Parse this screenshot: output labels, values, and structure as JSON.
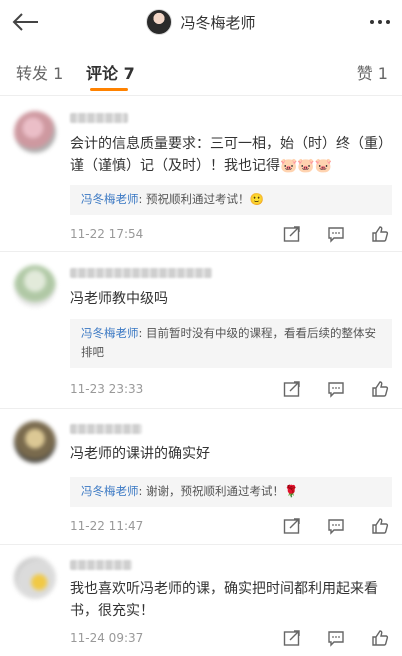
{
  "header": {
    "title": "冯冬梅老师"
  },
  "tabs": [
    {
      "label": "转发 1"
    },
    {
      "label": "评论 7"
    },
    {
      "label": "赞 1"
    }
  ],
  "colors": {
    "accent": "#ff8200",
    "link": "#3a78c3",
    "reply_bg": "#f5f5f5"
  },
  "comments": [
    {
      "text": "会计的信息质量要求：三可一相，始（时）终（重）谨（谨慎）记（及时）！我也记得🐷🐷🐷",
      "reply_author": "冯冬梅老师",
      "reply_text": ": 预祝顺利通过考试！🙂",
      "time": "11-22 17:54"
    },
    {
      "text": "冯老师教中级吗",
      "reply_author": "冯冬梅老师",
      "reply_text": ": 目前暂时没有中级的课程，看看后续的整体安排吧",
      "time": "11-23 23:33"
    },
    {
      "text": "冯老师的课讲的确实好",
      "reply_author": "冯冬梅老师",
      "reply_text": ": 谢谢，预祝顺利通过考试！🌹",
      "time": "11-22 11:47"
    },
    {
      "text": "我也喜欢听冯老师的课，确实把时间都利用起来看书，很充实！",
      "time": "11-24 09:37"
    }
  ]
}
